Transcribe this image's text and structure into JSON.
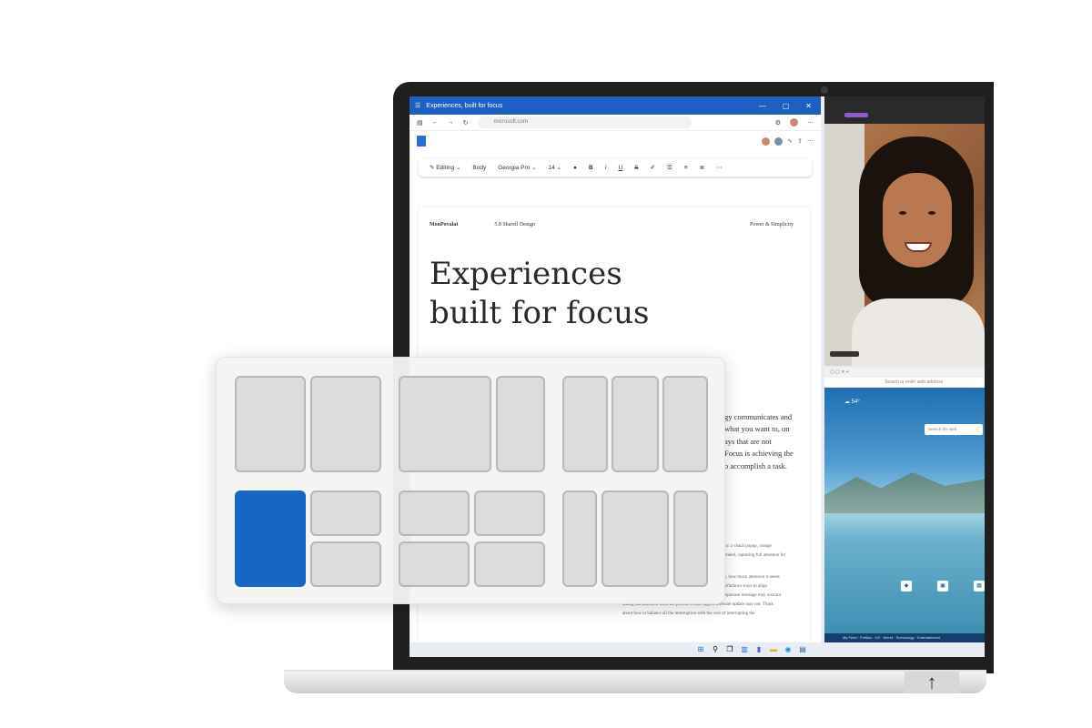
{
  "browser": {
    "title": "Experiences, built for focus",
    "url": "microsoft.com",
    "window_controls": [
      "—",
      "▢",
      "✕"
    ]
  },
  "toolbar": {
    "mode": "Editing",
    "style": "Body",
    "font": "Georgia Pro",
    "size": "14",
    "format_buttons": [
      "B",
      "I",
      "U",
      "S"
    ]
  },
  "document": {
    "header_left": "MonPovalat",
    "header_mid": "5.8 Sharell Design",
    "header_right": "Power & Simplicity",
    "headline_line1": "Experiences",
    "headline_line2": "built for focus",
    "body_lines": [
      "gy communicates and",
      "what you want to, on",
      "ays that are not",
      "Focus is achieving the",
      "o accomplish a task."
    ],
    "small_lines": [
      "in: a visual popup, orange",
      "ended, capturing full attention for",
      "s, how much attention it needs",
      "Windows ways to align",
      "the delivery form with the urgency of the message. An important message may warrant",
      "taking full attention from the person. A non-urgent software update may not. Think",
      "about how to balance all the interruption with the cost of interrupting the"
    ]
  },
  "edge": {
    "address": "Search or enter web address",
    "weather": "54°",
    "search": "Search the web",
    "tiles": [
      "Store",
      "LinkedIn",
      "Microsoft"
    ],
    "news": "My Feed  ·  Politics  ·  US  ·  World  ·  Technology  ·  Entertainment"
  },
  "taskbar": {
    "icons": [
      "windows-icon",
      "search-icon",
      "taskview-icon",
      "widgets-icon",
      "teams-icon",
      "explorer-icon",
      "edge-icon",
      "store-icon"
    ]
  },
  "laptop": {
    "arrow": "↑"
  },
  "colors": {
    "accent": "#1766c4",
    "titlebar": "#1f5fbf"
  }
}
